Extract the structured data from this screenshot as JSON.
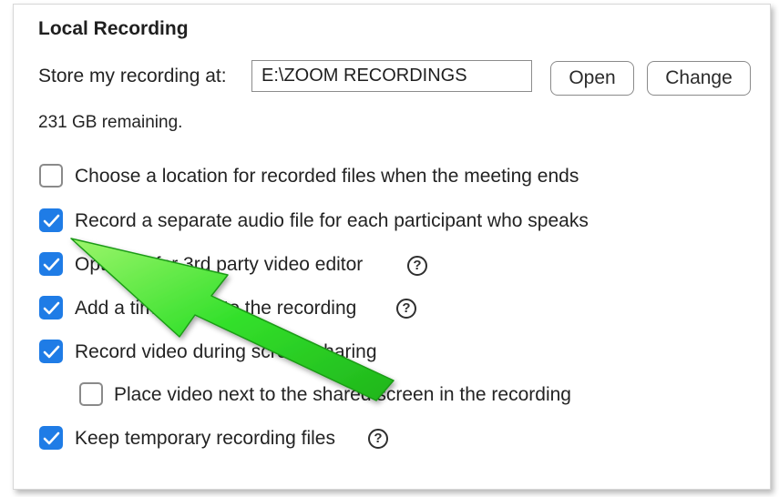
{
  "section_title": "Local Recording",
  "store": {
    "label": "Store my recording at:",
    "path": "E:\\ZOOM RECORDINGS",
    "open_label": "Open",
    "change_label": "Change",
    "remaining": "231 GB remaining."
  },
  "options": [
    {
      "label": "Choose a location for recorded files when the meeting ends",
      "checked": false
    },
    {
      "label": "Record a separate audio file for each participant who speaks",
      "checked": true
    },
    {
      "label": "Optimize for 3rd party video editor",
      "checked": true,
      "help": true
    },
    {
      "label": "Add a timestamp to the recording",
      "checked": true,
      "help": true
    },
    {
      "label": "Record video during screen sharing",
      "checked": true
    },
    {
      "label": "Place video next to the shared screen in the recording",
      "checked": false
    },
    {
      "label": "Keep temporary recording files",
      "checked": true,
      "help": true
    }
  ],
  "help_glyph": "?",
  "colors": {
    "checkbox_on": "#1f7ce6",
    "arrow": "#33e02b"
  }
}
